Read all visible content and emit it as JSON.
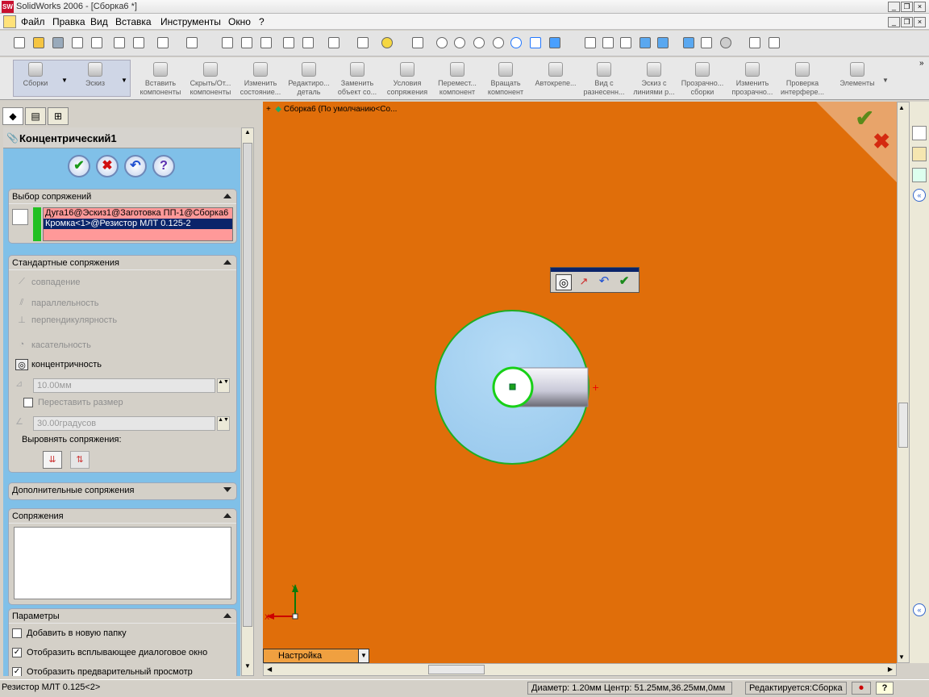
{
  "window": {
    "app_logo": "SW",
    "title": "SolidWorks 2006 - [Сборка6 *]"
  },
  "menu": [
    "Файл",
    "Правка",
    "Вид",
    "Вставка",
    "Инструменты",
    "Окно",
    "?"
  ],
  "toolbar2": [
    {
      "label": "Сборки"
    },
    {
      "label": "Эскиз"
    },
    {
      "label": "Вставить компоненты"
    },
    {
      "label": "Скрыть/От... компоненты"
    },
    {
      "label": "Изменить состояние..."
    },
    {
      "label": "Редактиро... деталь"
    },
    {
      "label": "Заменить объект со..."
    },
    {
      "label": "Условия сопряжения"
    },
    {
      "label": "Перемест... компонент"
    },
    {
      "label": "Вращать компонент"
    },
    {
      "label": "Автокрепе..."
    },
    {
      "label": "Вид с разнесенн..."
    },
    {
      "label": "Эскиз с линиями р..."
    },
    {
      "label": "Прозрачно... сборки"
    },
    {
      "label": "Изменить прозрачно..."
    },
    {
      "label": "Проверка интерфере..."
    },
    {
      "label": "Элементы"
    }
  ],
  "panel": {
    "title": "Концентрический1",
    "mate_selection": {
      "header": "Выбор сопряжений",
      "items": [
        "Дуга16@Эскиз1@Заготовка ПП-1@Сборка6",
        "Кромка<1>@Резистор МЛТ 0.125-2"
      ]
    },
    "standard_mates": {
      "header": "Стандартные сопряжения",
      "coincident": "совпадение",
      "parallel": "параллельность",
      "perpendicular": "перпендикулярность",
      "tangent": "касательность",
      "concentric": "концентричность",
      "distance_value": "10.00мм",
      "flip_dimension": "Переставить размер",
      "angle_value": "30.00градусов",
      "align_label": "Выровнять сопряжения:"
    },
    "advanced_header": "Дополнительные сопряжения",
    "mates_header": "Сопряжения",
    "options": {
      "header": "Параметры",
      "add_to_folder": "Добавить в новую папку",
      "show_popup": "Отобразить всплывающее диалоговое окно",
      "show_preview": "Отобразить предварительный просмотр"
    }
  },
  "viewport": {
    "tree_label": "Сборка6  (По умолчанию<Со...",
    "config_tab": "Настройка",
    "axis_x": "X",
    "axis_y": "Y"
  },
  "status": {
    "left": "Резистор МЛТ 0.125<2>",
    "measure": "Диаметр: 1.20мм  Центр: 51.25мм,36.25мм,0мм",
    "mode": "Редактируется:Сборка",
    "help": "?"
  },
  "colors": {
    "viewport_bg": "#e06e0a",
    "panel_bg": "#80c0e8",
    "disc": "#a7d0ee",
    "selection_pink": "#ff9999",
    "selection_blue": "#0a246a"
  }
}
